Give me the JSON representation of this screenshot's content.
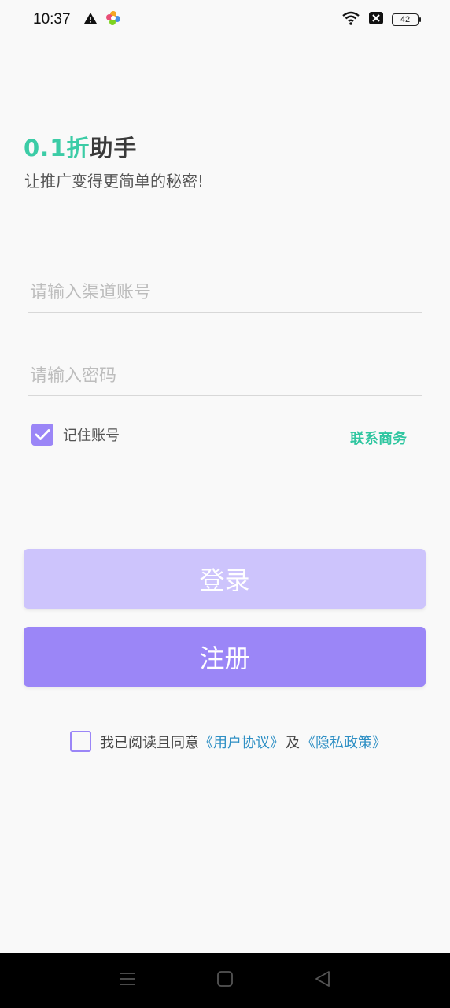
{
  "status_bar": {
    "time": "10:37",
    "battery": "42",
    "icons": [
      "warning-icon",
      "app-color-icon",
      "wifi-icon",
      "sim-off-icon",
      "battery-icon"
    ]
  },
  "brand": {
    "logo_part1": "0.1折",
    "logo_part2": "助手",
    "tagline": "让推广变得更简单的秘密!",
    "accent_color": "#3ccca6"
  },
  "form": {
    "account_placeholder": "请输入渠道账号",
    "password_placeholder": "请输入密码",
    "remember_label": "记住账号",
    "remember_checked": true,
    "contact_label": "联系商务"
  },
  "buttons": {
    "login_label": "登录",
    "register_label": "注册",
    "primary_color": "#9b86f7",
    "disabled_color": "#cdc4fc"
  },
  "agreement": {
    "prefix": "我已阅读且同意",
    "user_agreement": "《用户协议》",
    "conjunction": "及",
    "privacy_policy": "《隐私政策》",
    "checked": false
  },
  "nav_bar": {
    "icons": [
      "menu-icon",
      "home-icon",
      "back-icon"
    ]
  }
}
